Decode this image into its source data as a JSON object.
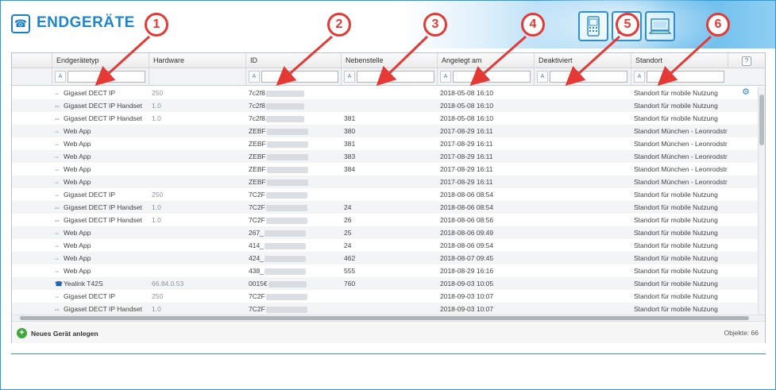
{
  "app": {
    "title": "ENDGERÄTE",
    "title_icon": "phone-icon",
    "device_tiles": [
      "mobile-phone-icon",
      "desk-phone-icon",
      "computer-icon"
    ]
  },
  "callouts": [
    "1",
    "2",
    "3",
    "4",
    "5",
    "6"
  ],
  "columns": [
    "Endgerätetyp",
    "Hardware",
    "ID",
    "Nebenstelle",
    "Angelegt am",
    "Deaktiviert",
    "Standort"
  ],
  "filter": {
    "button_label": "A",
    "placeholder": ""
  },
  "help_label": "?",
  "rows": [
    {
      "icon": "dect-icon",
      "type": "Gigaset DECT IP",
      "hardware": "250",
      "id": "7c2f8",
      "ext": "",
      "created": "2018-05-08 16:10",
      "deactivated": "",
      "location": "Standort für mobile Nutzung"
    },
    {
      "icon": "dect-handset-icon",
      "type": "Gigaset DECT IP Handset",
      "hardware": "1.0",
      "id": "7c2f8",
      "ext": "",
      "created": "2018-05-08 16:10",
      "deactivated": "",
      "location": "Standort für mobile Nutzung"
    },
    {
      "icon": "dect-handset-icon",
      "type": "Gigaset DECT IP Handset",
      "hardware": "1.0",
      "id": "7c2f8",
      "ext": "381",
      "created": "2018-05-08 16:10",
      "deactivated": "",
      "location": "Standort für mobile Nutzung"
    },
    {
      "icon": "web-app-icon",
      "type": "Web App",
      "hardware": "",
      "id": "ZEBF",
      "ext": "380",
      "created": "2017-08-29 16:11",
      "deactivated": "",
      "location": "Standort München - Leonrodstr..."
    },
    {
      "icon": "web-app-icon",
      "type": "Web App",
      "hardware": "",
      "id": "ZEBF",
      "ext": "381",
      "created": "2017-08-29 16:11",
      "deactivated": "",
      "location": "Standort München - Leonrodstr..."
    },
    {
      "icon": "web-app-icon",
      "type": "Web App",
      "hardware": "",
      "id": "ZEBF",
      "ext": "383",
      "created": "2017-08-29 16:11",
      "deactivated": "",
      "location": "Standort München - Leonrodstr..."
    },
    {
      "icon": "web-app-icon",
      "type": "Web App",
      "hardware": "",
      "id": "ZEBF",
      "ext": "384",
      "created": "2017-08-29 16:11",
      "deactivated": "",
      "location": "Standort München - Leonrodstr..."
    },
    {
      "icon": "web-app-icon",
      "type": "Web App",
      "hardware": "",
      "id": "ZEBF",
      "ext": "",
      "created": "2017-08-29 16:11",
      "deactivated": "",
      "location": "Standort München - Leonrodstr..."
    },
    {
      "icon": "dect-icon",
      "type": "Gigaset DECT IP",
      "hardware": "250",
      "id": "7C2F",
      "ext": "",
      "created": "2018-08-06 08:54",
      "deactivated": "",
      "location": "Standort für mobile Nutzung"
    },
    {
      "icon": "dect-handset-icon",
      "type": "Gigaset DECT IP Handset",
      "hardware": "1.0",
      "id": "7C2F",
      "ext": "24",
      "created": "2018-08-06 08:54",
      "deactivated": "",
      "location": "Standort für mobile Nutzung"
    },
    {
      "icon": "dect-handset-icon",
      "type": "Gigaset DECT IP Handset",
      "hardware": "1.0",
      "id": "7C2F",
      "ext": "26",
      "created": "2018-08-06 08:56",
      "deactivated": "",
      "location": "Standort für mobile Nutzung"
    },
    {
      "icon": "web-app-icon",
      "type": "Web App",
      "hardware": "",
      "id": "267_",
      "ext": "25",
      "created": "2018-08-06 09:49",
      "deactivated": "",
      "location": "Standort für mobile Nutzung"
    },
    {
      "icon": "web-app-icon",
      "type": "Web App",
      "hardware": "",
      "id": "414_",
      "ext": "24",
      "created": "2018-08-06 09:54",
      "deactivated": "",
      "location": "Standort für mobile Nutzung"
    },
    {
      "icon": "web-app-icon",
      "type": "Web App",
      "hardware": "",
      "id": "424_",
      "ext": "462",
      "created": "2018-08-07 09:45",
      "deactivated": "",
      "location": "Standort für mobile Nutzung"
    },
    {
      "icon": "web-app-icon",
      "type": "Web App",
      "hardware": "",
      "id": "438_",
      "ext": "555",
      "created": "2018-08-29 16:16",
      "deactivated": "",
      "location": "Standort für mobile Nutzung"
    },
    {
      "icon": "yealink-icon",
      "type": "Yealink T42S",
      "hardware": "66.84.0.53",
      "id": "0015€",
      "ext": "760",
      "created": "2018-09-03 10:05",
      "deactivated": "",
      "location": "Standort für mobile Nutzung"
    },
    {
      "icon": "dect-icon",
      "type": "Gigaset DECT IP",
      "hardware": "250",
      "id": "7C2F",
      "ext": "",
      "created": "2018-09-03 10:07",
      "deactivated": "",
      "location": "Standort für mobile Nutzung"
    },
    {
      "icon": "dect-handset-icon",
      "type": "Gigaset DECT IP Handset",
      "hardware": "1.0",
      "id": "7C2F",
      "ext": "",
      "created": "2018-09-03 10:07",
      "deactivated": "",
      "location": "Standort für mobile Nutzung"
    }
  ],
  "footer": {
    "add_label": "Neues Gerät anlegen",
    "count_label": "Objekte: 66"
  }
}
